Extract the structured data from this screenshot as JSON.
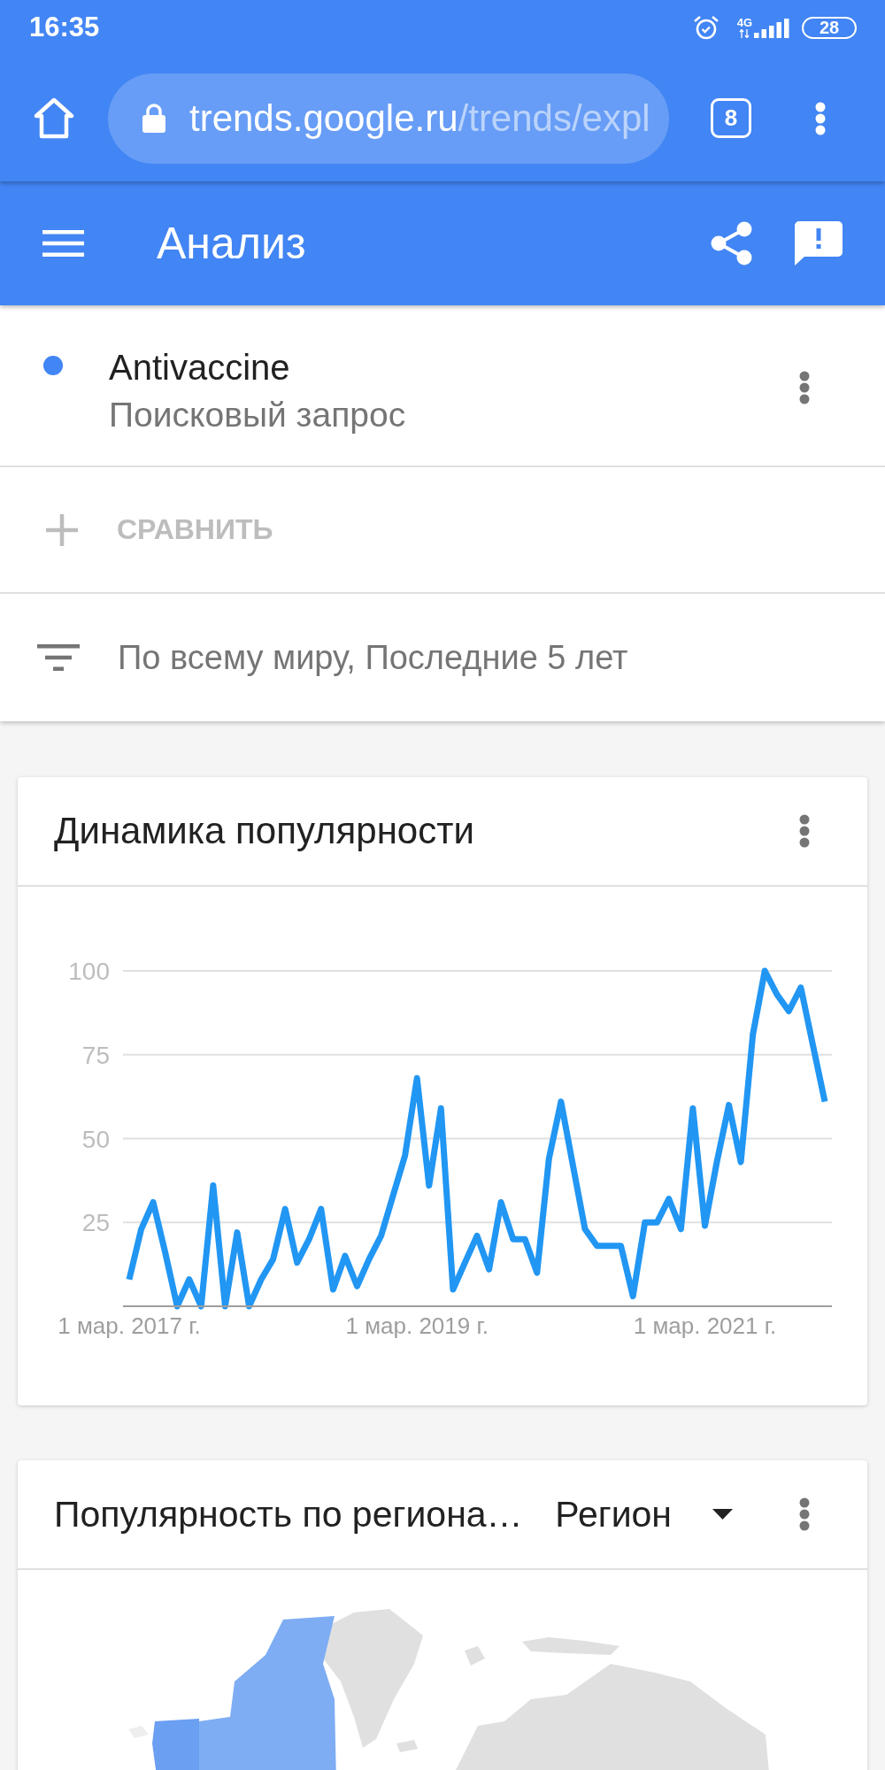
{
  "status_bar": {
    "time": "16:35",
    "network": "4G",
    "battery": "28"
  },
  "browser": {
    "url": {
      "host": "trends.google.ru",
      "path": "/trends/expl"
    },
    "tab_count": "8"
  },
  "app_bar": {
    "title": "Анализ"
  },
  "search_terms": [
    {
      "term": "Antivaccine",
      "type_label": "Поисковый запрос",
      "color": "#4285f4"
    }
  ],
  "compare": {
    "label": "СРАВНИТЬ"
  },
  "filters": {
    "text": "По всему миру, Последние 5 лет"
  },
  "interest_over_time": {
    "title": "Динамика популярности",
    "chart_data": {
      "type": "line",
      "categories": [
        "1 мар. 2017 г.",
        null,
        null,
        null,
        null,
        null,
        null,
        null,
        null,
        null,
        null,
        null,
        null,
        null,
        null,
        null,
        null,
        null,
        null,
        null,
        null,
        null,
        null,
        null,
        "1 мар. 2019 г.",
        null,
        null,
        null,
        null,
        null,
        null,
        null,
        null,
        null,
        null,
        null,
        null,
        null,
        null,
        null,
        null,
        null,
        null,
        null,
        null,
        null,
        null,
        null,
        "1 мар. 2021 г.",
        null,
        null,
        null,
        null,
        null,
        null,
        null,
        null,
        null,
        null
      ],
      "ylim": [
        0,
        100
      ],
      "grid": true,
      "yticks": [
        25,
        50,
        75,
        100
      ],
      "series": [
        {
          "color": "#2196f3",
          "values": [
            8,
            23,
            31,
            16,
            0,
            8,
            0,
            36,
            0,
            22,
            0,
            8,
            14,
            29,
            13,
            20,
            29,
            5,
            15,
            6,
            14,
            21,
            33,
            45,
            68,
            36,
            59,
            5,
            13,
            21,
            11,
            31,
            20,
            20,
            10,
            44,
            61,
            42,
            23,
            18,
            18,
            18,
            3,
            25,
            25,
            32,
            23,
            59,
            24,
            43,
            60,
            43,
            81,
            100,
            93,
            88,
            95,
            78,
            61
          ]
        }
      ]
    }
  },
  "interest_by_region": {
    "title": "Популярность по региона…",
    "dropdown": "Регион"
  }
}
